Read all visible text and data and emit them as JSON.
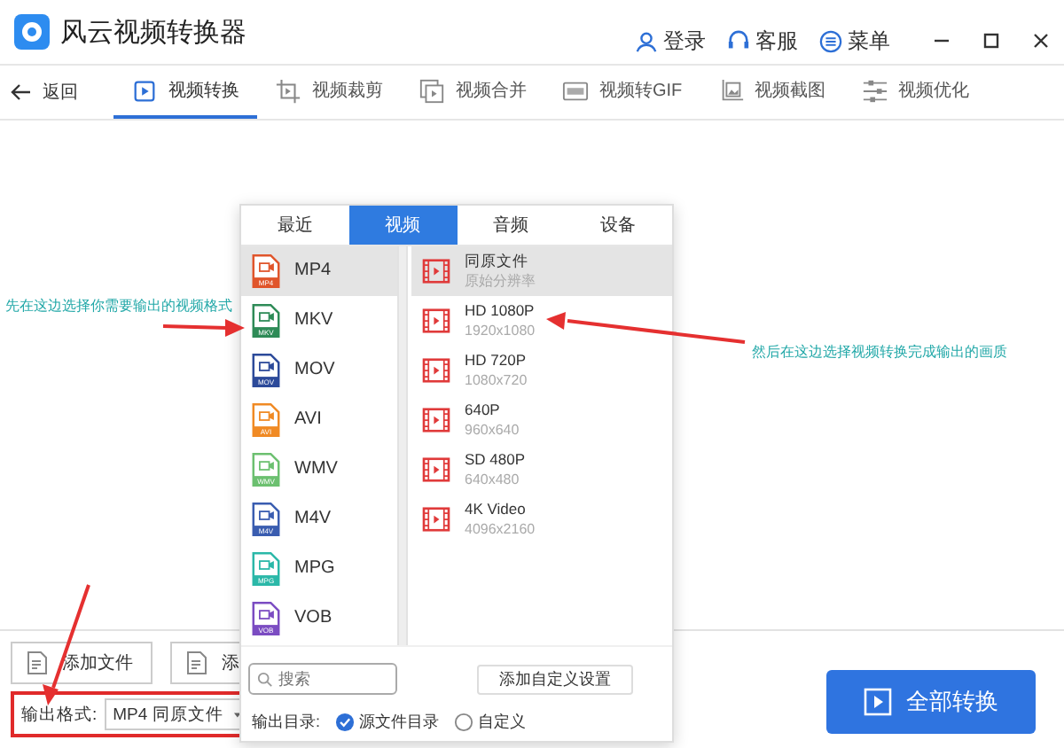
{
  "window": {
    "title": "风云视频转换器"
  },
  "header_actions": [
    {
      "label": "登录",
      "kind": "user"
    },
    {
      "label": "客服",
      "kind": "headset"
    },
    {
      "label": "菜单",
      "kind": "menu"
    }
  ],
  "nav": {
    "back": "返回",
    "tabs": [
      {
        "label": "视频转换",
        "kind": "convert",
        "selected": true
      },
      {
        "label": "视频裁剪",
        "kind": "crop",
        "selected": false
      },
      {
        "label": "视频合并",
        "kind": "merge",
        "selected": false
      },
      {
        "label": "视频转GIF",
        "kind": "gif",
        "selected": false
      },
      {
        "label": "视频截图",
        "kind": "shot",
        "selected": false
      },
      {
        "label": "视频优化",
        "kind": "tune",
        "selected": false
      }
    ]
  },
  "file_buttons": [
    "添加文件",
    "添"
  ],
  "output_format": {
    "label": "输出格式:",
    "value": "MP4 同原文件"
  },
  "convert_button": "全部转换",
  "popup": {
    "tabs": [
      {
        "label": "最近",
        "selected": false
      },
      {
        "label": "视频",
        "selected": true
      },
      {
        "label": "音频",
        "selected": false
      },
      {
        "label": "设备",
        "selected": false
      }
    ],
    "formats": [
      {
        "name": "MP4",
        "badge": "MP4",
        "color": "#e0552b",
        "selected": true
      },
      {
        "name": "MKV",
        "badge": "MKV",
        "color": "#2e8b57",
        "selected": false
      },
      {
        "name": "MOV",
        "badge": "MOV",
        "color": "#2c4a9a",
        "selected": false
      },
      {
        "name": "AVI",
        "badge": "AVI",
        "color": "#f08a24",
        "selected": false
      },
      {
        "name": "WMV",
        "badge": "WMV",
        "color": "#6cc070",
        "selected": false
      },
      {
        "name": "M4V",
        "badge": "M4V",
        "color": "#3a5db0",
        "selected": false
      },
      {
        "name": "MPG",
        "badge": "MPG",
        "color": "#2bb8a8",
        "selected": false
      },
      {
        "name": "VOB",
        "badge": "VOB",
        "color": "#7b4cc2",
        "selected": false
      }
    ],
    "presets": [
      {
        "title": "同原文件",
        "subtitle": "原始分辨率",
        "selected": true
      },
      {
        "title": "HD 1080P",
        "subtitle": "1920x1080",
        "selected": false
      },
      {
        "title": "HD 720P",
        "subtitle": "1080x720",
        "selected": false
      },
      {
        "title": "640P",
        "subtitle": "960x640",
        "selected": false
      },
      {
        "title": "SD 480P",
        "subtitle": "640x480",
        "selected": false
      },
      {
        "title": "4K Video",
        "subtitle": "4096x2160",
        "selected": false
      }
    ],
    "search": {
      "placeholder": "搜索"
    },
    "custom_button": "添加自定义设置",
    "output_dir": {
      "label": "输出目录:",
      "options": [
        {
          "label": "源文件目录",
          "selected": true
        },
        {
          "label": "自定义",
          "selected": false
        }
      ]
    }
  },
  "annotations": [
    "先在这边选择你需要输出的视频格式",
    "然后在这边选择视频转换完成输出的画质"
  ]
}
